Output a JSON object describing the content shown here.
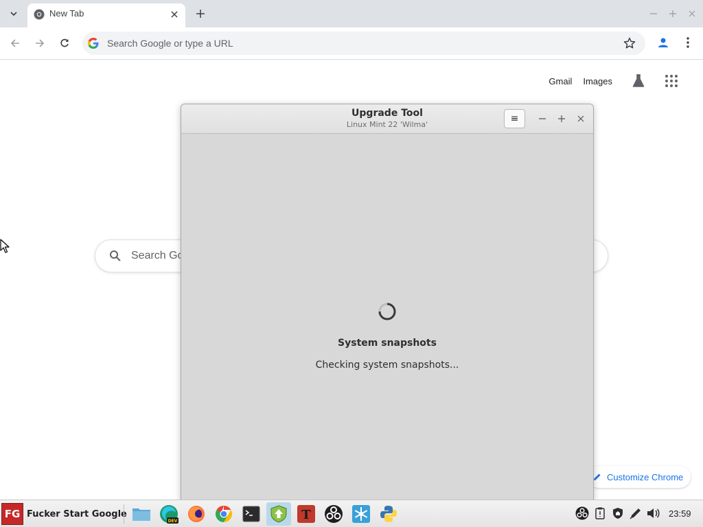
{
  "browser": {
    "tab": {
      "title": "New Tab"
    },
    "omnibox": {
      "placeholder": "Search Google or type a URL"
    }
  },
  "ntp": {
    "links": {
      "gmail": "Gmail",
      "images": "Images"
    },
    "search_placeholder": "Search Go",
    "customize_label": "Customize Chrome"
  },
  "dialog": {
    "title": "Upgrade Tool",
    "subtitle": "Linux Mint 22 'Wilma'",
    "menu_icon": "≡",
    "status_title": "System snapshots",
    "status_text": "Checking system snapshots..."
  },
  "taskbar": {
    "start_logo": "FG",
    "start_label": "Fucker Start Google",
    "launchers": [
      "file-manager-icon",
      "edge-dev-icon",
      "firefox-icon",
      "chrome-icon",
      "terminal-icon",
      "mint-upgrade-icon",
      "font-app-icon",
      "obs-icon",
      "snowflake-app-icon",
      "python-icon"
    ],
    "active_launcher": "mint-upgrade-icon",
    "tray": [
      "obs-tray-icon",
      "clipboard-icon",
      "shield-icon",
      "pen-icon",
      "volume-icon"
    ],
    "clock": "23:59"
  },
  "colors": {
    "accent_blue": "#1a73e8",
    "dialog_bg": "#d8d8d8",
    "start_red": "#c62828"
  }
}
